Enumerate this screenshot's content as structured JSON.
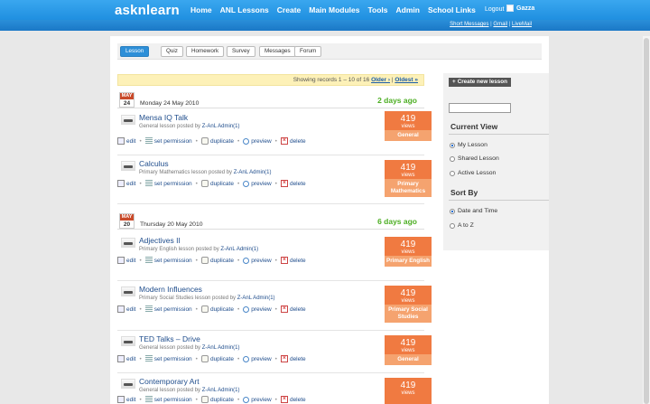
{
  "header": {
    "logo": "asknlearn",
    "nav": [
      "Home",
      "ANL Lessons",
      "Create",
      "Main Modules",
      "Tools",
      "Admin",
      "School Links"
    ],
    "logout": "Logout",
    "user": "Gazza",
    "sub_links": [
      "Short Messages",
      "Gmail",
      "LiveMail"
    ],
    "sub_sep": " | "
  },
  "tabs": [
    {
      "label": "Lesson",
      "active": true
    },
    {
      "label": "Quiz"
    },
    {
      "label": "Homework"
    },
    {
      "label": "Survey"
    },
    {
      "label": "Messages"
    },
    {
      "label": "Forum"
    }
  ],
  "records": {
    "text": "Showing records 1 – 10 of 16",
    "older": "Older ›",
    "oldest": "Oldest »"
  },
  "actions": {
    "edit": "edit",
    "set_permission": "set permission",
    "duplicate": "duplicate",
    "preview": "preview",
    "delete": "delete",
    "sep": "•"
  },
  "groups": [
    {
      "month": "MAY",
      "day": "24",
      "date": "Monday 24 May 2010",
      "ago": "2 days ago"
    },
    {
      "month": "MAY",
      "day": "20",
      "date": "Thursday 20 May 2010",
      "ago": "6 days ago"
    }
  ],
  "lessons": [
    {
      "title": "Mensa IQ Talk",
      "sub": "General lesson posted by",
      "author": "Z-AnL Admin(1)",
      "views": "419",
      "views_label": "views",
      "category": "General"
    },
    {
      "title": "Calculus",
      "sub": "Primary Mathematics lesson posted by",
      "author": "Z-AnL Admin(1)",
      "views": "419",
      "views_label": "views",
      "category": "Primary Mathematics"
    },
    {
      "title": "Adjectives II",
      "sub": "Primary English lesson posted by",
      "author": "Z-AnL Admin(1)",
      "views": "419",
      "views_label": "views",
      "category": "Primary English"
    },
    {
      "title": "Modern Influences",
      "sub": "Primary Social Studies lesson posted by",
      "author": "Z-AnL Admin(1)",
      "views": "419",
      "views_label": "views",
      "category": "Primary Social Studies"
    },
    {
      "title": "TED Talks – Drive",
      "sub": "General lesson posted by",
      "author": "Z-AnL Admin(1)",
      "views": "419",
      "views_label": "views",
      "category": "General"
    },
    {
      "title": "Contemporary Art",
      "sub": "General lesson posted by",
      "author": "Z-AnL Admin(1)",
      "views": "419",
      "views_label": "views",
      "category": ""
    }
  ],
  "sidebar": {
    "new_lesson": "Create new lesson",
    "current_view": "Current View",
    "views": [
      {
        "label": "My Lesson",
        "checked": true
      },
      {
        "label": "Shared Lesson",
        "checked": false
      },
      {
        "label": "Active Lesson",
        "checked": false
      }
    ],
    "sort_by": "Sort By",
    "sorts": [
      {
        "label": "Date and Time",
        "checked": true
      },
      {
        "label": "A to Z",
        "checked": false
      }
    ]
  },
  "colors": {
    "brand": "#1f8fe0",
    "views_box": "#f07a41",
    "ago": "#4cae22",
    "calendar": "#c94a2a"
  }
}
